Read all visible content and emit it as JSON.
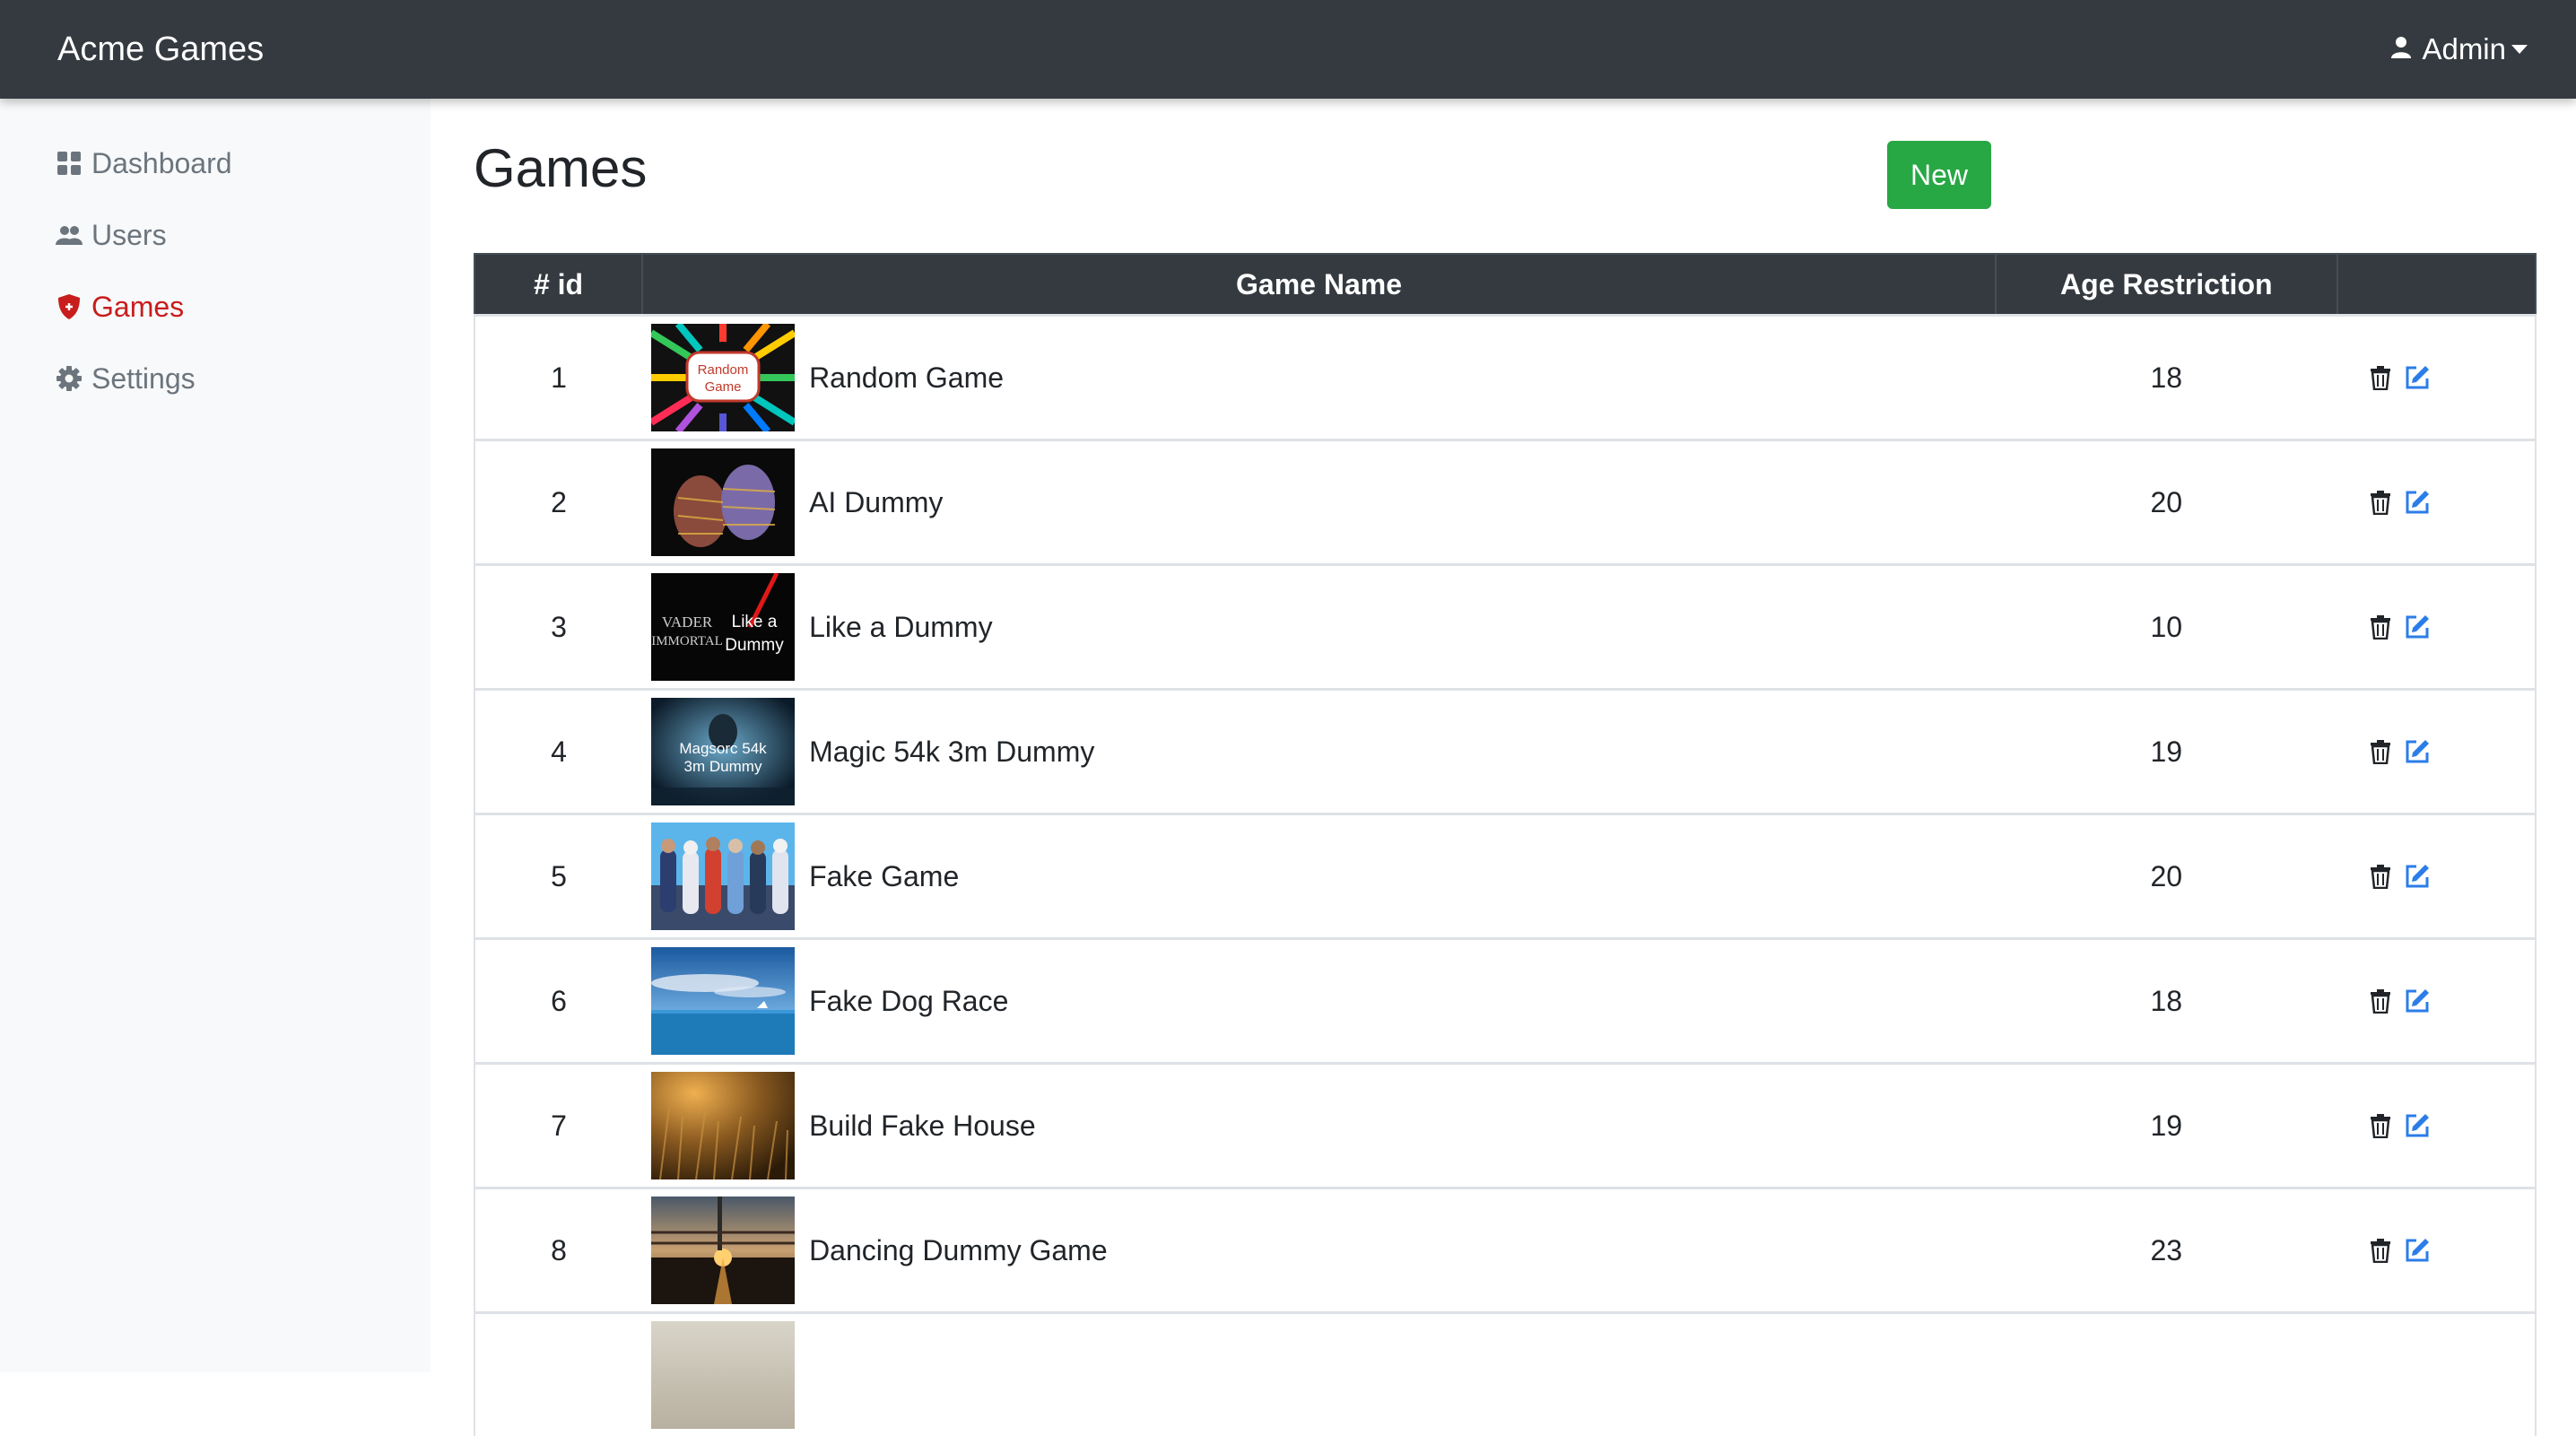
{
  "app": {
    "brand": "Acme Games"
  },
  "user_menu": {
    "label": "Admin",
    "icon": "user-icon"
  },
  "sidebar": {
    "items": [
      {
        "label": "Dashboard",
        "icon": "dashboard-icon",
        "active": false
      },
      {
        "label": "Users",
        "icon": "users-icon",
        "active": false
      },
      {
        "label": "Games",
        "icon": "shield-icon",
        "active": true
      },
      {
        "label": "Settings",
        "icon": "gear-icon",
        "active": false
      }
    ]
  },
  "page": {
    "title": "Games",
    "new_button": "New"
  },
  "table": {
    "headers": {
      "id": "# id",
      "name": "Game Name",
      "age": "Age Restriction"
    },
    "rows": [
      {
        "id": "1",
        "name": "Random Game",
        "age": "18",
        "thumb_text": [
          "Random",
          "Game"
        ]
      },
      {
        "id": "2",
        "name": "AI Dummy",
        "age": "20"
      },
      {
        "id": "3",
        "name": "Like a Dummy",
        "age": "10",
        "thumb_text": [
          "VADER",
          "IMMORTAL",
          "Like a",
          "Dummy"
        ]
      },
      {
        "id": "4",
        "name": "Magic 54k 3m Dummy",
        "age": "19",
        "thumb_text": [
          "Magsorc 54k",
          "3m Dummy"
        ]
      },
      {
        "id": "5",
        "name": "Fake Game",
        "age": "20"
      },
      {
        "id": "6",
        "name": "Fake Dog Race",
        "age": "18"
      },
      {
        "id": "7",
        "name": "Build Fake House",
        "age": "19"
      },
      {
        "id": "8",
        "name": "Dancing Dummy Game",
        "age": "23"
      }
    ]
  },
  "colors": {
    "navbar": "#343a40",
    "sidebar": "#f8f9fa",
    "active_nav": "#c81d1d",
    "new_button": "#28a745",
    "edit_icon": "#2b7de9"
  }
}
